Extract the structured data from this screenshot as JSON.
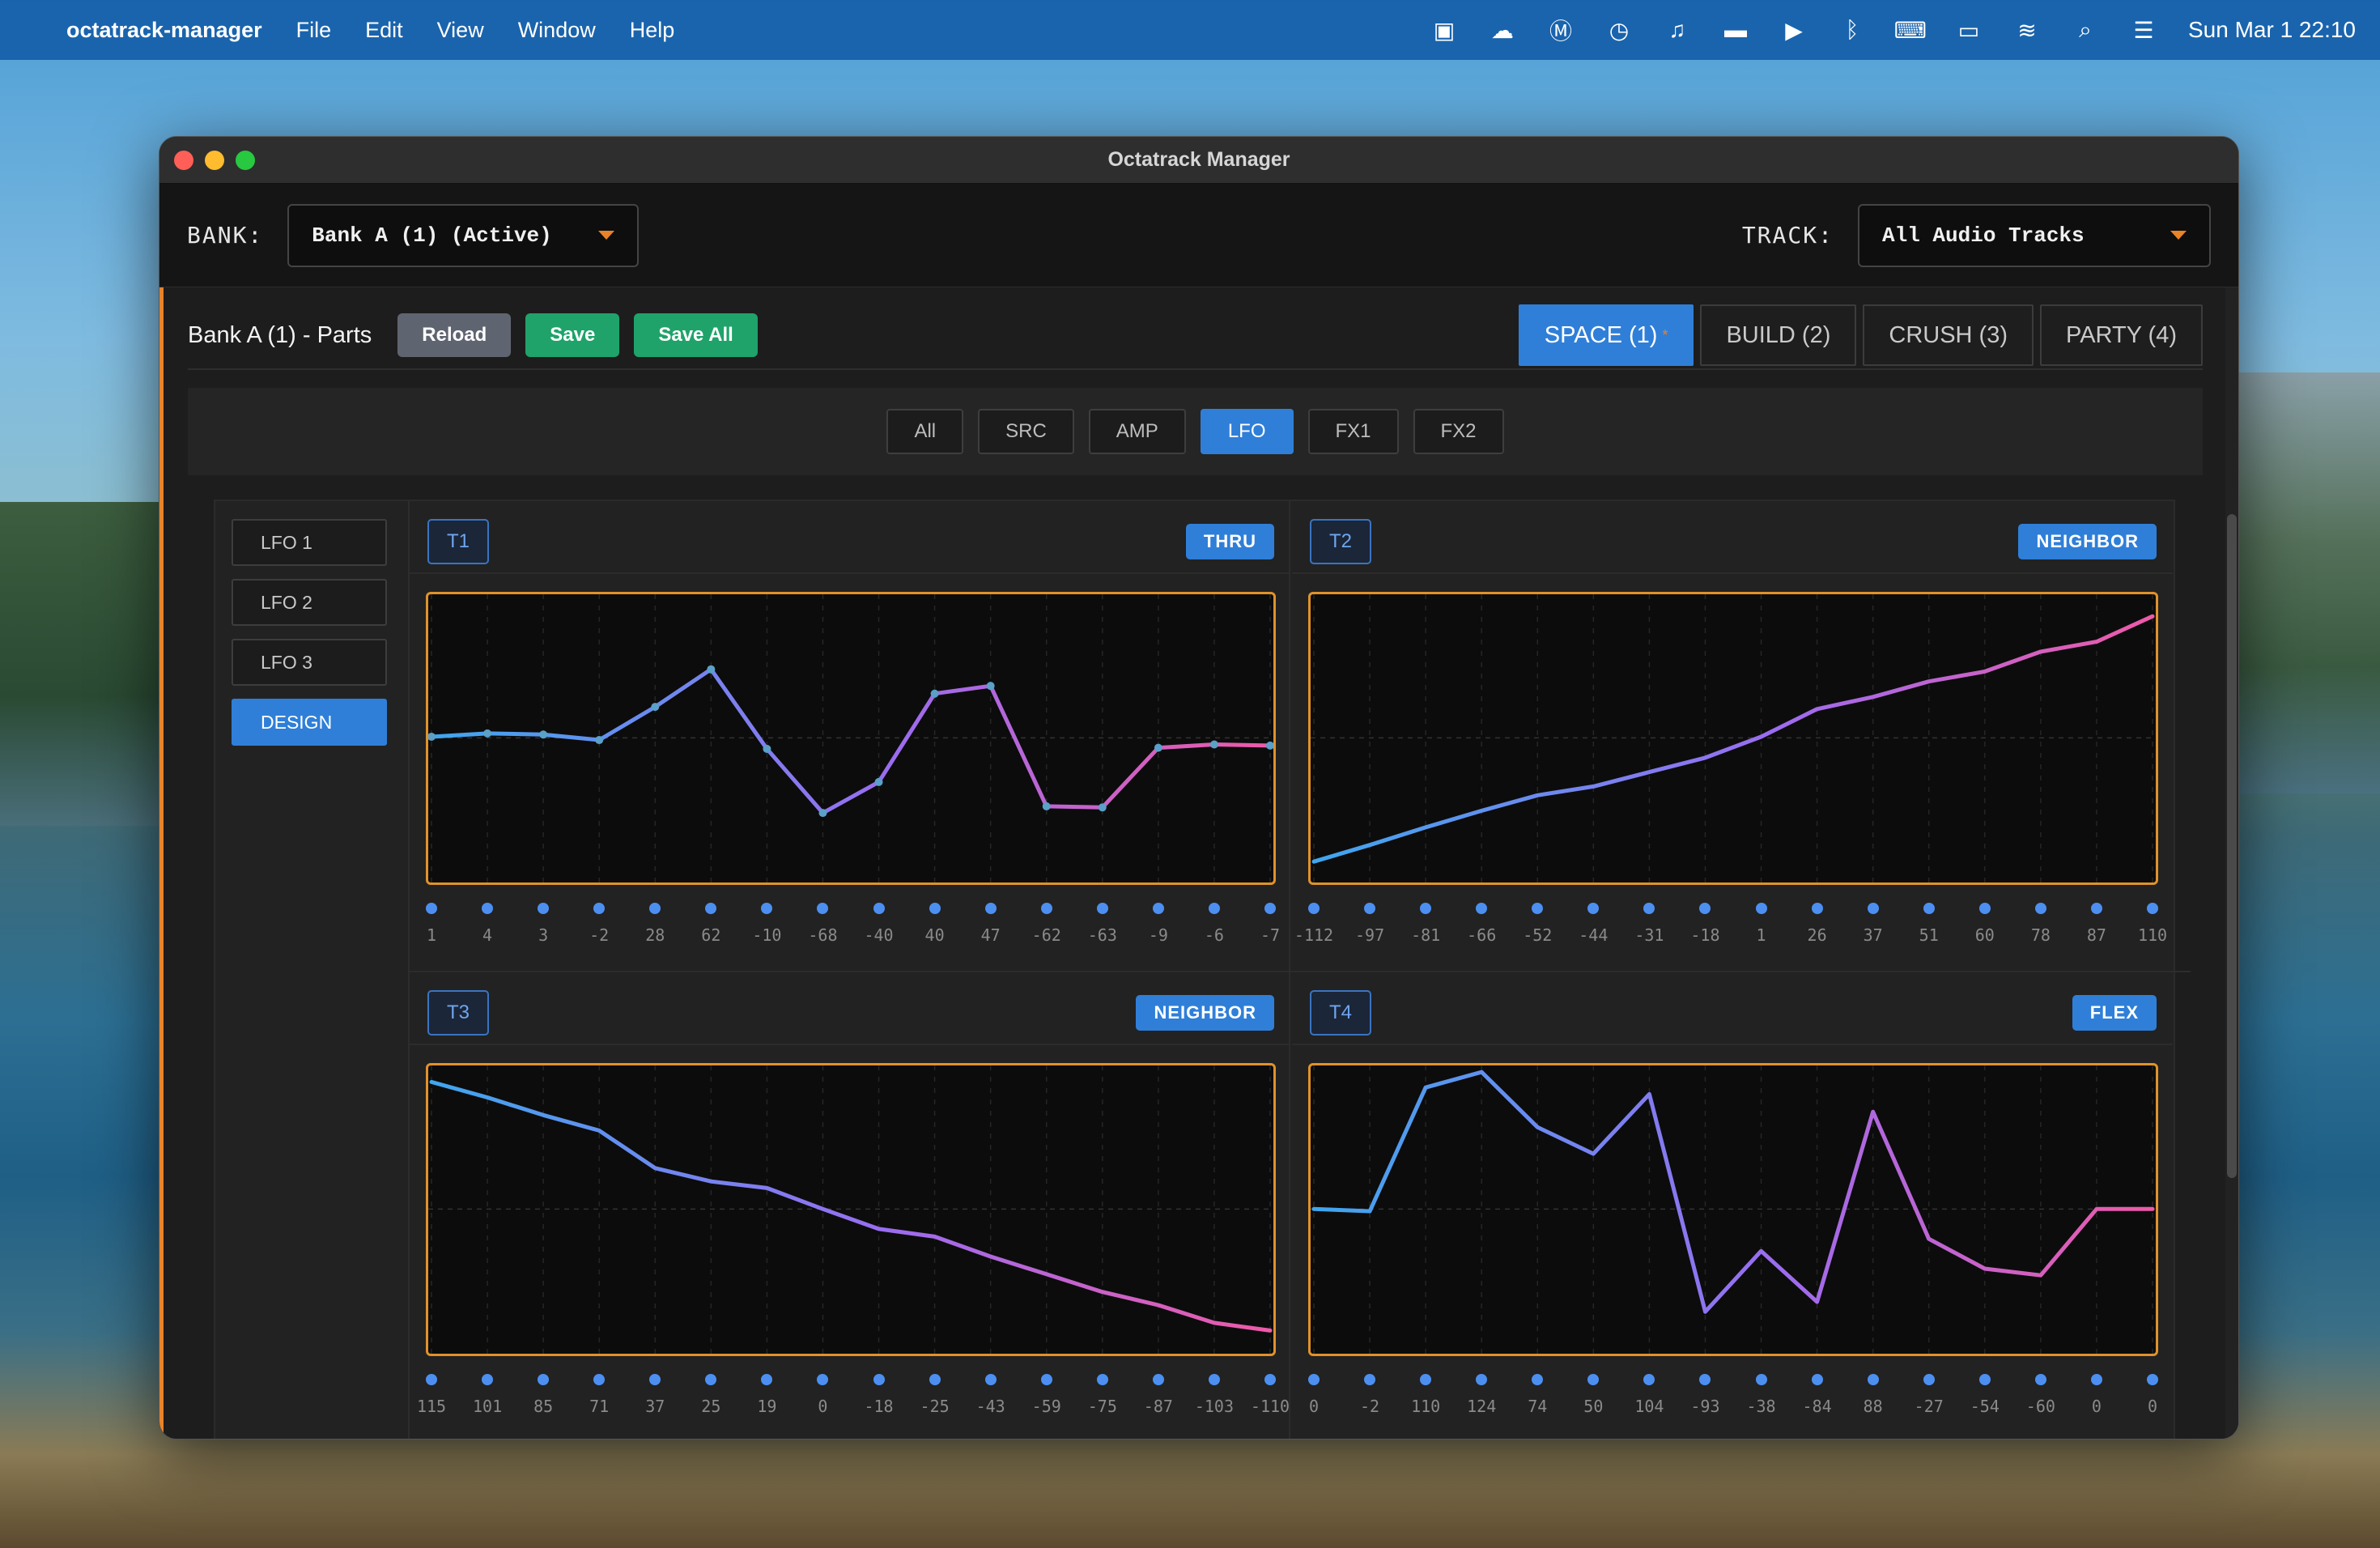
{
  "menubar": {
    "app_name": "octatrack-manager",
    "menus": [
      "File",
      "Edit",
      "View",
      "Window",
      "Help"
    ],
    "status_icons": [
      "text-input-icon",
      "cloud-icon",
      "m-app-icon",
      "time-machine-icon",
      "headphones-icon",
      "bed-icon",
      "play-circle-icon",
      "bluetooth-icon",
      "keyboard-icon",
      "battery-icon",
      "wifi-icon",
      "search-icon",
      "control-center-icon"
    ],
    "clock": "Sun Mar 1  22:10"
  },
  "window": {
    "title": "Octatrack Manager"
  },
  "topbar": {
    "bank_label": "BANK:",
    "bank_value": "Bank A (1) (Active)",
    "track_label": "TRACK:",
    "track_value": "All Audio Tracks"
  },
  "parts": {
    "title": "Bank A (1) - Parts",
    "reload": "Reload",
    "save": "Save",
    "save_all": "Save All",
    "tabs": [
      {
        "label": "SPACE (1)",
        "active": true,
        "modified_mark": "*"
      },
      {
        "label": "BUILD (2)",
        "active": false
      },
      {
        "label": "CRUSH (3)",
        "active": false
      },
      {
        "label": "PARTY (4)",
        "active": false
      }
    ]
  },
  "filters": [
    {
      "label": "All",
      "active": false
    },
    {
      "label": "SRC",
      "active": false
    },
    {
      "label": "AMP",
      "active": false
    },
    {
      "label": "LFO",
      "active": true
    },
    {
      "label": "FX1",
      "active": false
    },
    {
      "label": "FX2",
      "active": false
    }
  ],
  "lfo_list": [
    {
      "label": "LFO 1",
      "active": false
    },
    {
      "label": "LFO 2",
      "active": false
    },
    {
      "label": "LFO 3",
      "active": false
    },
    {
      "label": "DESIGN",
      "active": true
    }
  ],
  "colors": {
    "accent": "#2f7fd8",
    "orange": "#e8832a",
    "green": "#1fa36a",
    "line_start": "#3fa6ee",
    "line_mid": "#9b6cf0",
    "line_end": "#ee5aa8"
  },
  "chart_data": [
    {
      "type": "line",
      "track": "T1",
      "mode": "THRU",
      "ylim": [
        -128,
        127
      ],
      "x": [
        1,
        2,
        3,
        4,
        5,
        6,
        7,
        8,
        9,
        10,
        11,
        12,
        13,
        14,
        15,
        16
      ],
      "values": [
        1,
        4,
        3,
        -2,
        28,
        62,
        -10,
        -68,
        -40,
        40,
        47,
        -62,
        -63,
        -9,
        -6,
        -7
      ],
      "labels": [
        "1",
        "4",
        "3",
        "-2",
        "28",
        "62",
        "-10",
        "-68",
        "-40",
        "40",
        "47",
        "-62",
        "-63",
        "-9",
        "-6",
        "-7"
      ],
      "show_points": true
    },
    {
      "type": "line",
      "track": "T2",
      "mode": "NEIGHBOR",
      "ylim": [
        -128,
        127
      ],
      "x": [
        1,
        2,
        3,
        4,
        5,
        6,
        7,
        8,
        9,
        10,
        11,
        12,
        13,
        14,
        15,
        16
      ],
      "values": [
        -112,
        -97,
        -81,
        -66,
        -52,
        -44,
        -31,
        -18,
        1,
        26,
        37,
        51,
        60,
        78,
        87,
        110
      ],
      "labels": [
        "-112",
        "-97",
        "-81",
        "-66",
        "-52",
        "-44",
        "-31",
        "-18",
        "1",
        "26",
        "37",
        "51",
        "60",
        "78",
        "87",
        "110"
      ],
      "show_points": false
    },
    {
      "type": "line",
      "track": "T3",
      "mode": "NEIGHBOR",
      "ylim": [
        -128,
        127
      ],
      "x": [
        1,
        2,
        3,
        4,
        5,
        6,
        7,
        8,
        9,
        10,
        11,
        12,
        13,
        14,
        15,
        16
      ],
      "values": [
        115,
        101,
        85,
        71,
        37,
        25,
        19,
        0,
        -18,
        -25,
        -43,
        -59,
        -75,
        -87,
        -103,
        -110
      ],
      "labels": [
        "115",
        "101",
        "85",
        "71",
        "37",
        "25",
        "19",
        "0",
        "-18",
        "-25",
        "-43",
        "-59",
        "-75",
        "-87",
        "-103",
        "-110"
      ],
      "show_points": false
    },
    {
      "type": "line",
      "track": "T4",
      "mode": "FLEX",
      "ylim": [
        -128,
        127
      ],
      "x": [
        1,
        2,
        3,
        4,
        5,
        6,
        7,
        8,
        9,
        10,
        11,
        12,
        13,
        14,
        15,
        16
      ],
      "values": [
        0,
        -2,
        110,
        124,
        74,
        50,
        104,
        -93,
        -38,
        -84,
        88,
        -27,
        -54,
        -60,
        0,
        0
      ],
      "labels": [
        "0",
        "-2",
        "110",
        "124",
        "74",
        "50",
        "104",
        "-93",
        "-38",
        "-84",
        "88",
        "-27",
        "-54",
        "-60",
        "0",
        "0"
      ],
      "show_points": false
    }
  ]
}
